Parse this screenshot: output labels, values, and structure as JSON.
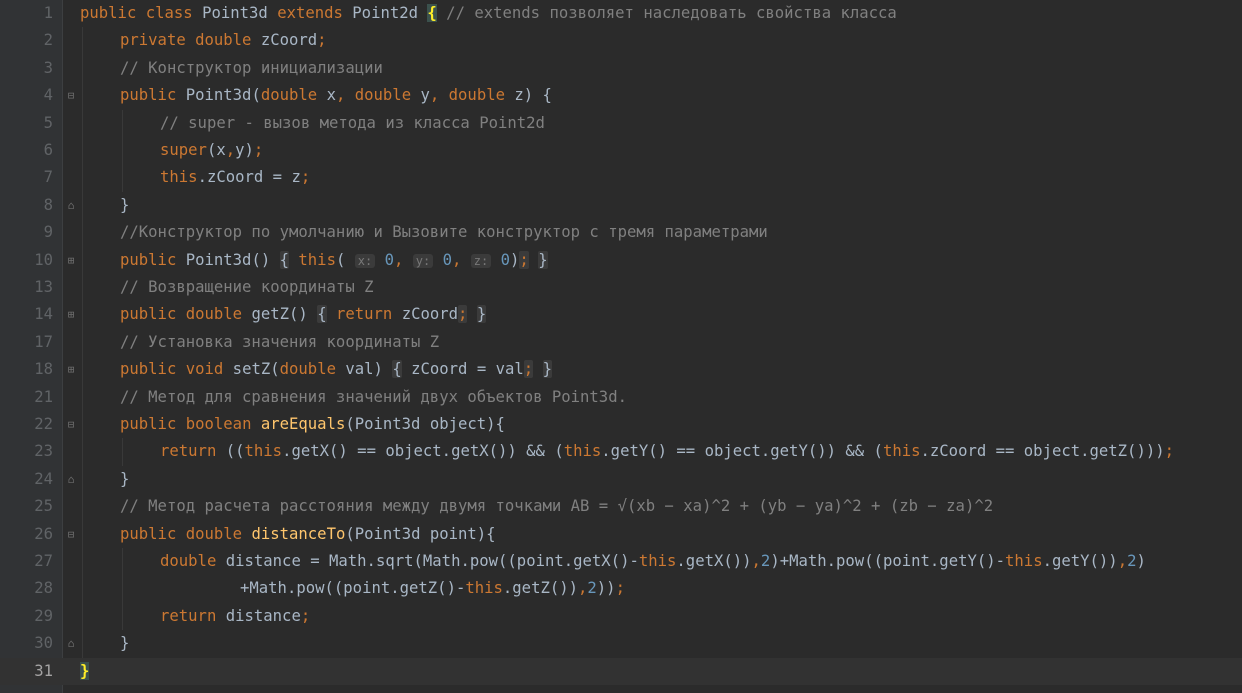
{
  "editor": {
    "current_line": "31",
    "lines": [
      {
        "n": "1",
        "fold": ""
      },
      {
        "n": "2",
        "fold": ""
      },
      {
        "n": "3",
        "fold": ""
      },
      {
        "n": "4",
        "fold": "open"
      },
      {
        "n": "5",
        "fold": ""
      },
      {
        "n": "6",
        "fold": ""
      },
      {
        "n": "7",
        "fold": ""
      },
      {
        "n": "8",
        "fold": "end"
      },
      {
        "n": "9",
        "fold": ""
      },
      {
        "n": "10",
        "fold": "collapsed"
      },
      {
        "n": "13",
        "fold": ""
      },
      {
        "n": "14",
        "fold": "collapsed"
      },
      {
        "n": "17",
        "fold": ""
      },
      {
        "n": "18",
        "fold": "collapsed"
      },
      {
        "n": "21",
        "fold": ""
      },
      {
        "n": "22",
        "fold": "open"
      },
      {
        "n": "23",
        "fold": ""
      },
      {
        "n": "24",
        "fold": "end"
      },
      {
        "n": "25",
        "fold": ""
      },
      {
        "n": "26",
        "fold": "open"
      },
      {
        "n": "27",
        "fold": ""
      },
      {
        "n": "28",
        "fold": ""
      },
      {
        "n": "29",
        "fold": ""
      },
      {
        "n": "30",
        "fold": "end"
      },
      {
        "n": "31",
        "fold": ""
      }
    ],
    "tokens": {
      "l1": [
        "public",
        " ",
        "class",
        " Point3d ",
        "extends",
        " Point2d ",
        "{",
        " // extends позволяет наследовать свойства класса"
      ],
      "l2": [
        "private",
        " ",
        "double",
        " zCoord",
        ";"
      ],
      "l3": [
        "// Конструктор инициализации"
      ],
      "l4": [
        "public",
        " Point3d(",
        "double",
        " x",
        ",",
        " ",
        "double",
        " y",
        ",",
        " ",
        "double",
        " z) {"
      ],
      "l5": [
        "// super - вызов метода из класса Point2d"
      ],
      "l6": [
        "super",
        "(x",
        ",",
        "y)",
        ";"
      ],
      "l7": [
        "this",
        ".zCoord = z",
        ";"
      ],
      "l8": [
        "}"
      ],
      "l9": [
        "//Конструктор по умолчанию и Вызовите конструктор с тремя параметрами"
      ],
      "l10": [
        "public",
        " Point3d() ",
        "{",
        " ",
        "this",
        "( ",
        "x:",
        " ",
        "0",
        ", ",
        "y:",
        " ",
        "0",
        ", ",
        "z:",
        " ",
        "0",
        ")",
        ";",
        " ",
        "}"
      ],
      "l13": [
        "// Возвращение координаты Z"
      ],
      "l14": [
        "public",
        " ",
        "double",
        " getZ() ",
        "{",
        " ",
        "return",
        " zCoord",
        ";",
        " ",
        "}"
      ],
      "l17": [
        "// Установка значения координаты Z"
      ],
      "l18": [
        "public",
        " ",
        "void",
        " setZ(",
        "double",
        " val) ",
        "{",
        " zCoord = val",
        ";",
        " ",
        "}"
      ],
      "l21": [
        "// Метод для сравнения значений двух объектов Point3d."
      ],
      "l22": [
        "public",
        " ",
        "boolean",
        " ",
        "areEquals",
        "(Point3d object){"
      ],
      "l23": [
        "return",
        " ((",
        "this",
        ".getX() == object.getX()) && (",
        "this",
        ".getY() == object.getY()) && (",
        "this",
        ".zCoord == object.getZ()))",
        ";"
      ],
      "l24": [
        "}"
      ],
      "l25": [
        "// Метод расчета расстояния между двумя точками AB = √(xb − xa)^2 + (yb − ya)^2 + (zb − za)^2"
      ],
      "l26": [
        "public",
        " ",
        "double",
        " ",
        "distanceTo",
        "(Point3d point){"
      ],
      "l27": [
        "double",
        " distance = Math.",
        "sqrt",
        "(Math.",
        "pow",
        "((point.getX()-",
        "this",
        ".getX())",
        ",",
        "2",
        ")+Math.",
        "pow",
        "((point.getY()-",
        "this",
        ".getY())",
        ",",
        "2",
        ")"
      ],
      "l28": [
        "+Math.",
        "pow",
        "((point.getZ()-",
        "this",
        ".getZ())",
        ",",
        "2",
        "))",
        ";"
      ],
      "l29": [
        "return",
        " distance",
        ";"
      ],
      "l30": [
        "}"
      ],
      "l31": [
        "}"
      ]
    }
  },
  "colors": {
    "background": "#2b2b2b",
    "keyword": "#cc7832",
    "comment": "#808080",
    "number": "#6897bb",
    "text": "#a9b7c6",
    "brace_highlight": "#ffef28"
  }
}
